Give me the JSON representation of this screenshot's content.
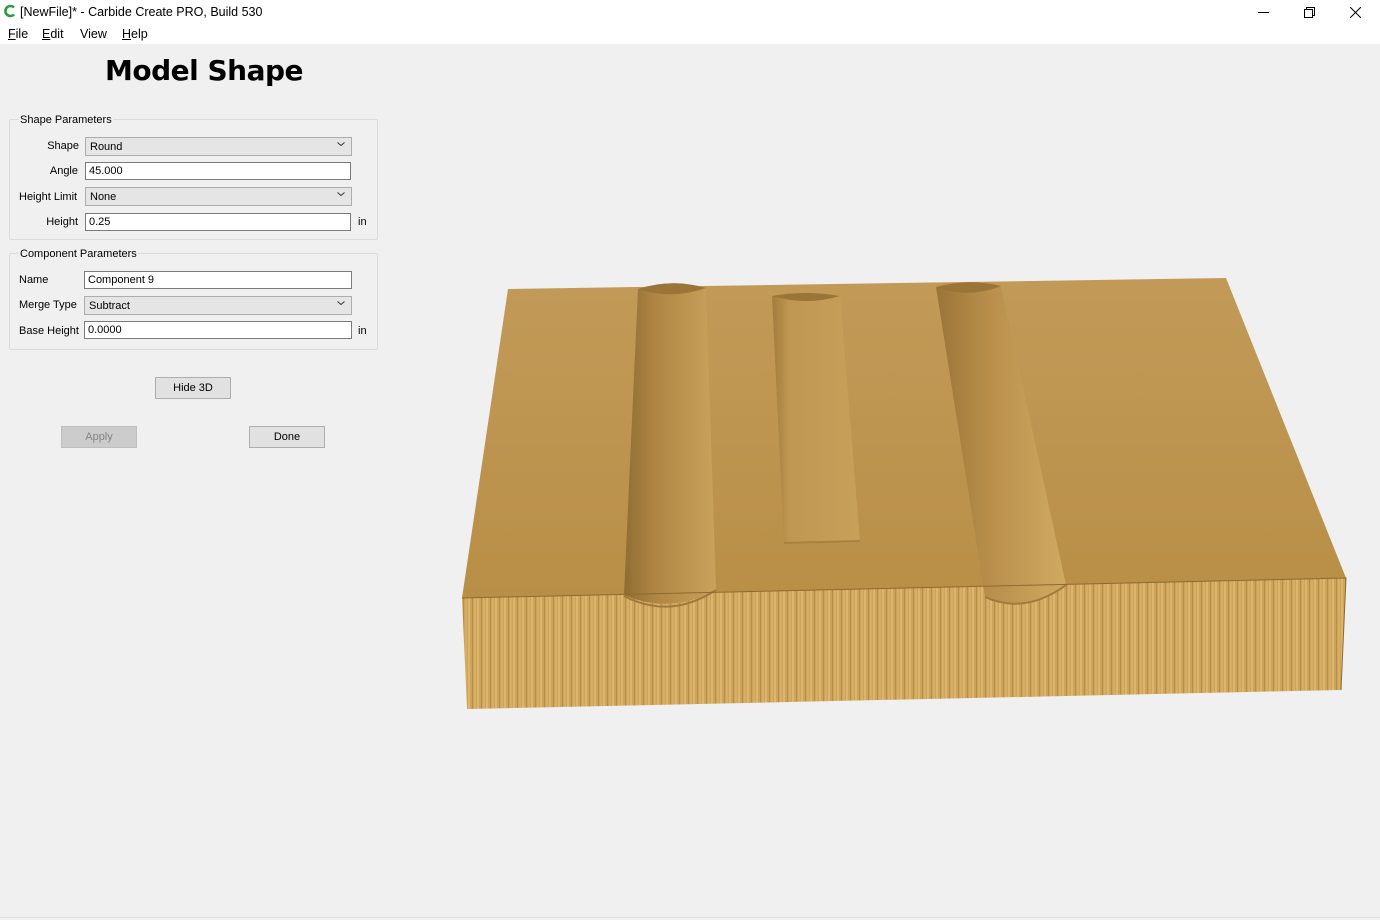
{
  "window": {
    "title": "[NewFile]* - Carbide Create PRO, Build 530",
    "icon": "carbide-create-icon",
    "controls": [
      "minimize-icon",
      "restore-icon",
      "close-icon"
    ]
  },
  "menu": {
    "file": {
      "u": "F",
      "rest": "ile"
    },
    "edit": {
      "u": "E",
      "rest": "dit"
    },
    "view": {
      "u": "",
      "rest": "View"
    },
    "help": {
      "u": "H",
      "rest": "elp"
    }
  },
  "page_title": "Model Shape",
  "shape_parameters": {
    "title": "Shape Parameters",
    "shape_label": "Shape",
    "shape_value": "Round",
    "angle_label": "Angle",
    "angle_value": "45.000",
    "height_limit_label": "Height Limit",
    "height_limit_value": "None",
    "height_label": "Height",
    "height_value": "0.25",
    "height_unit": "in"
  },
  "component_parameters": {
    "title": "Component Parameters",
    "name_label": "Name",
    "name_value": "Component 9",
    "merge_type_label": "Merge Type",
    "merge_type_value": "Subtract",
    "base_height_label": "Base Height",
    "base_height_value": "0.0000",
    "base_height_unit": "in"
  },
  "buttons": {
    "hide3d": "Hide 3D",
    "apply": "Apply",
    "done": "Done"
  },
  "colors": {
    "wood_top": "#c39a52",
    "wood_side": "#caa35a",
    "groove_shadow": "#9c7a3c",
    "window_bg": "#f0f0f0"
  }
}
